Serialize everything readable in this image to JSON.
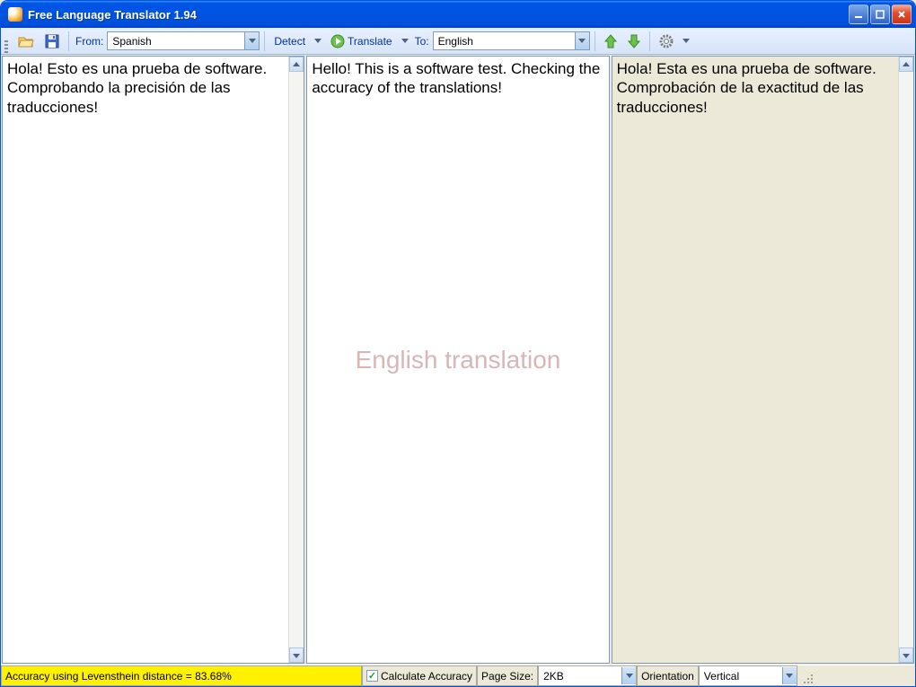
{
  "window": {
    "title": "Free Language Translator 1.94"
  },
  "toolbar": {
    "from_label": "From:",
    "from_value": "Spanish",
    "detect_label": "Detect",
    "translate_label": "Translate",
    "to_label": "To:",
    "to_value": "English"
  },
  "panes": {
    "source_text": "Hola! Esto es una prueba de software. Comprobando la precisión de las traducciones!",
    "translation_text": "Hello! This is a software test. Checking the accuracy of the translations!",
    "back_translation_text": "Hola! Esta es una prueba de software. Comprobación de la exactitud de las traducciones!",
    "watermark": "English translation"
  },
  "statusbar": {
    "accuracy_text": "Accuracy using Levensthein distance = 83.68%",
    "calc_label": "Calculate Accuracy",
    "page_size_label": "Page Size:",
    "page_size_value": "2KB",
    "orientation_label": "Orientation",
    "orientation_value": "Vertical"
  }
}
